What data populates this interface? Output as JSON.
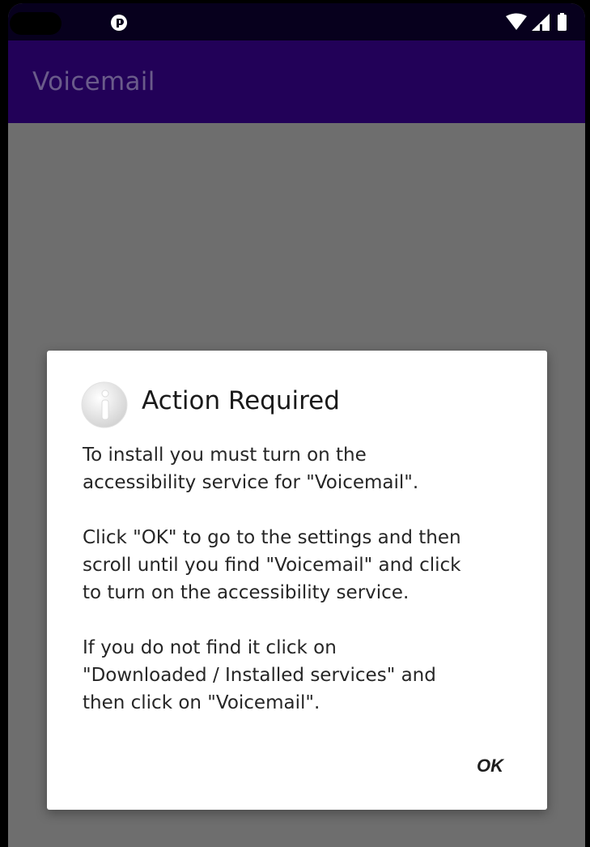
{
  "status_bar": {
    "notification_icon": "status-notification-icon",
    "wifi_icon": "wifi-icon",
    "signal_icon": "cell-signal-icon",
    "battery_icon": "battery-icon",
    "background": "#07001d"
  },
  "app_bar": {
    "title": "Voicemail",
    "background": "#220158"
  },
  "dialog": {
    "icon": "info-icon",
    "title": "Action Required",
    "paragraphs": [
      {
        "lines": [
          "To install you must turn on the",
          "accessibility service for \"Voicemail\"."
        ]
      },
      {
        "lines": [
          "Click \"OK\" to go to the settings and then",
          "scroll until you find \"Voicemail\" and click",
          "to turn on the accessibility service."
        ]
      },
      {
        "lines": [
          "If you do not find it click on",
          "\"Downloaded / Installed services\" and",
          "then click on \"Voicemail\"."
        ]
      }
    ],
    "ok_label": "OK"
  },
  "colors": {
    "scrim": "#6e6e6e",
    "dialog_background": "#ffffff"
  }
}
